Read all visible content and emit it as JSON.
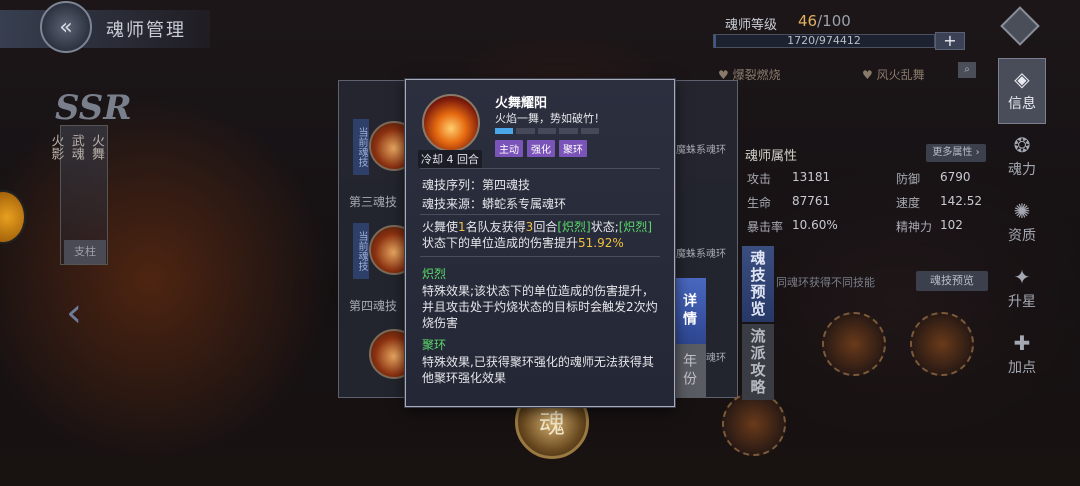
{
  "header": {
    "title": "魂师管理"
  },
  "character": {
    "rarity": "SSR",
    "plate_lines": [
      "火舞",
      "武魂",
      "火影"
    ],
    "tag": "支柱"
  },
  "list_panel": {
    "current_skill_tag": "当前魂技",
    "row3_label": "第三魂技",
    "row4_label": "第四魂技",
    "right_text_1": "魔蛛系魂环",
    "right_text_2": "魔蛛系魂环",
    "right_text_3": "魔蛛系魂环",
    "tab_detail": "详情",
    "tab_year": "年份"
  },
  "emblem": {
    "label": "魂"
  },
  "rank": {
    "label": "魂师等级",
    "level": "46",
    "max": "/100",
    "exp_text": "1720/974412",
    "exp_fraction": 0.0018,
    "plus": "+"
  },
  "skills_header": {
    "skill_a": "♥ 爆裂燃烧",
    "skill_b": "♥ 风火乱舞"
  },
  "attributes": {
    "title": "魂师属性",
    "more": "更多属性 ›",
    "attack_label": "攻击",
    "attack": "13181",
    "defense_label": "防御",
    "defense": "6790",
    "hp_label": "生命",
    "hp": "87761",
    "speed_label": "速度",
    "speed": "142.52",
    "crit_label": "暴击率",
    "crit": "10.60%",
    "spirit_label": "精神力",
    "spirit": "102"
  },
  "preview": {
    "note": "同魂环获得不同技能",
    "button": "魂技预览",
    "tab_preview": "魂技预览",
    "tab_school": "流派攻略"
  },
  "right_nav": [
    {
      "label": "信息",
      "icon": "◈",
      "active": true
    },
    {
      "label": "魂力",
      "icon": "❂",
      "active": false
    },
    {
      "label": "资质",
      "icon": "✺",
      "active": false
    },
    {
      "label": "升星",
      "icon": "✦",
      "active": false
    },
    {
      "label": "加点",
      "icon": "✚",
      "active": false
    }
  ],
  "tooltip": {
    "name": "火舞耀阳",
    "desc": "火焰一舞，势如破竹！",
    "cooldown": "冷却 4 回合",
    "bar_filled": 1,
    "bar_total": 5,
    "tags": [
      "主动",
      "强化",
      "聚环"
    ],
    "sequence": "魂技序列：第四魂技",
    "source": "魂技来源：蟒蛇系专属魂环",
    "effect_p1": "火舞使",
    "effect_n1": "1",
    "effect_p2": "名队友获得",
    "effect_n2": "3",
    "effect_p3": "回合",
    "effect_s1": "[炽烈]",
    "effect_p4": "状态;",
    "effect_s2": "[炽烈]",
    "effect_p5": "状态下的单位造成的伤害提升",
    "effect_pct": "51.92%",
    "sub1_title": "炽烈",
    "sub1_body": "特殊效果;该状态下的单位造成的伤害提升，并且攻击处于灼烧状态的目标时会触发2次灼烧伤害",
    "sub2_title": "聚环",
    "sub2_body": "特殊效果,已获得聚环强化的魂师无法获得其他聚环强化效果"
  },
  "colors": {
    "accent_blue": "#4a68c0",
    "tag_purple": "#7a54b8",
    "highlight_yellow": "#f0c040",
    "highlight_green": "#5ad86a"
  }
}
